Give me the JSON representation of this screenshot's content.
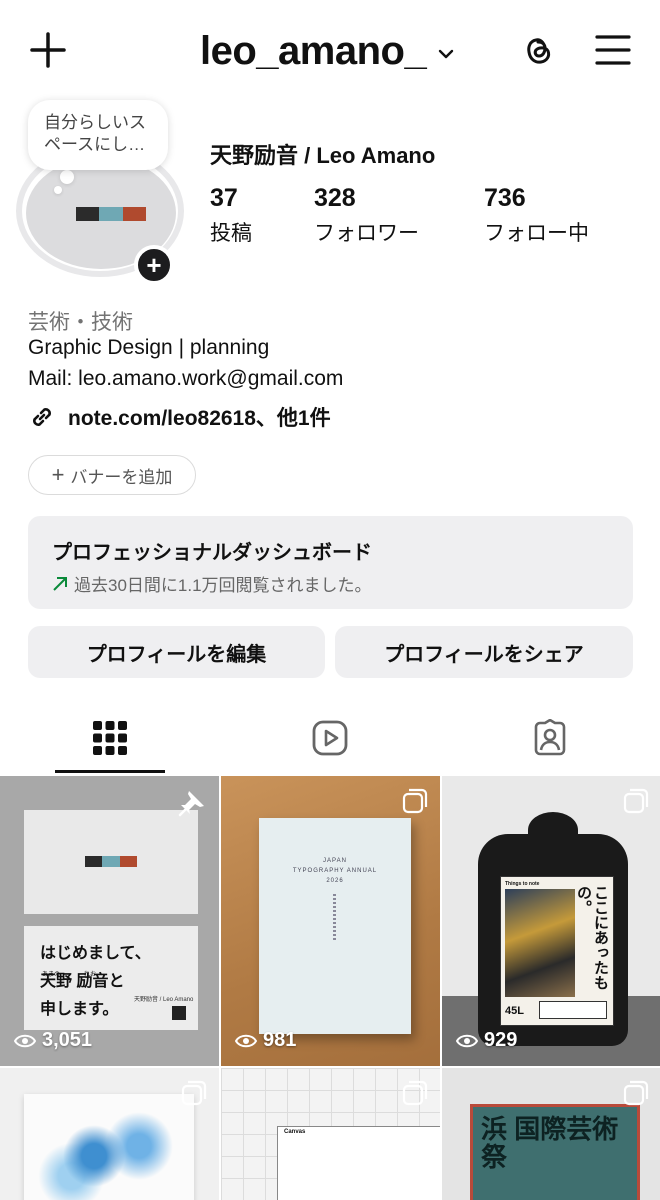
{
  "header": {
    "username": "leo_amano_",
    "icons": {
      "create": "plus-icon",
      "dropdown": "chevron-down-icon",
      "threads": "threads-icon",
      "menu": "hamburger-menu-icon"
    }
  },
  "profile": {
    "note": "自分らしいスペースにし…",
    "display_name": "天野励音 / Leo Amano",
    "stats": [
      {
        "value": "37",
        "label": "投稿"
      },
      {
        "value": "328",
        "label": "フォロワー"
      },
      {
        "value": "736",
        "label": "フォロー中"
      }
    ],
    "category": "芸術・技術",
    "bio_lines": [
      "Graphic Design | planning",
      "Mail: leo.amano.work@gmail.com"
    ],
    "link": "note.com/leo82618、他1件",
    "banner_button": "バナーを追加",
    "avatar_colors": [
      "#2b2b2b",
      "#6fa8b4",
      "#b04a2e"
    ]
  },
  "dashboard": {
    "title": "プロフェッショナルダッシュボード",
    "subtitle": "過去30日間に1.1万回閲覧されました。"
  },
  "actions": {
    "edit": "プロフィールを編集",
    "share": "プロフィールをシェア"
  },
  "tabs": [
    {
      "name": "grid",
      "icon": "grid-icon",
      "selected": true
    },
    {
      "name": "reels",
      "icon": "reels-icon",
      "selected": false
    },
    {
      "name": "tagged",
      "icon": "tagged-icon",
      "selected": false
    }
  ],
  "posts": [
    {
      "views": "3,051",
      "pinned": true,
      "card_text": [
        "はじめまして、",
        "天野 励音と",
        "申します。"
      ],
      "card_small": "天野励音 / Leo Amano",
      "card_ruby": [
        "あまの",
        "れお"
      ]
    },
    {
      "views": "981",
      "pinned": false,
      "book_title": [
        "JAPAN",
        "TYPOGRAPHY ANNUAL",
        "2026"
      ]
    },
    {
      "views": "929",
      "pinned": false,
      "poster_text": "ここにあったもの。",
      "poster_tag": "Things to note",
      "poster_size": "45L"
    },
    {
      "views": "",
      "pinned": false
    },
    {
      "views": "",
      "pinned": false,
      "canvas_label": "Canvas"
    },
    {
      "views": "",
      "pinned": false,
      "poster_text": "浜 国際芸術祭"
    }
  ]
}
